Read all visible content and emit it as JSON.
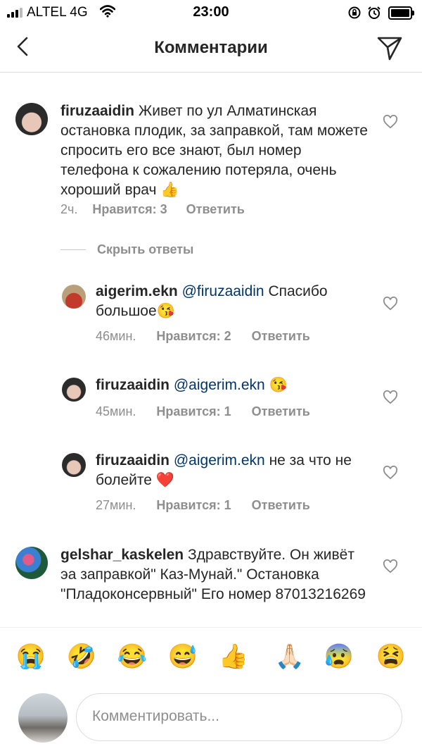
{
  "status_bar": {
    "carrier": "ALTEL 4G",
    "time": "23:00"
  },
  "header": {
    "title": "Комментарии"
  },
  "comments": [
    {
      "username": "firuzaaidin",
      "text": "Живет по ул Алматинская остановка плодик, за заправкой, там можете спросить его все знают, был номер телефона к сожалению потеряла, очень хороший врач 👍",
      "time": "2ч.",
      "likes": "Нравится: 3",
      "reply": "Ответить"
    }
  ],
  "hide_replies": "Скрыть ответы",
  "replies": [
    {
      "username": "aigerim.ekn",
      "mention": "@firuzaaidin",
      "text": " Спасибо большое😘",
      "time": "46мин.",
      "likes": "Нравится: 2",
      "reply": "Ответить"
    },
    {
      "username": "firuzaaidin",
      "mention": "@aigerim.ekn",
      "text": " 😘",
      "time": "45мин.",
      "likes": "Нравится: 1",
      "reply": "Ответить"
    },
    {
      "username": "firuzaaidin",
      "mention": "@aigerim.ekn",
      "text": " не за что не болейте ❤️",
      "time": "27мин.",
      "likes": "Нравится: 1",
      "reply": "Ответить"
    }
  ],
  "comment2": {
    "username": "gelshar_kaskelen",
    "text": "Здравствуйте. Он живёт эа заправкой\" Каз-Мунай.\" Остановка \"Пладоконсервный\" Его номер 87013216269"
  },
  "emoji_bar": [
    "😭",
    "🤣",
    "😂",
    "😅",
    "👍",
    "🙏🏻",
    "😰",
    "😫"
  ],
  "composer": {
    "placeholder": "Комментировать..."
  }
}
